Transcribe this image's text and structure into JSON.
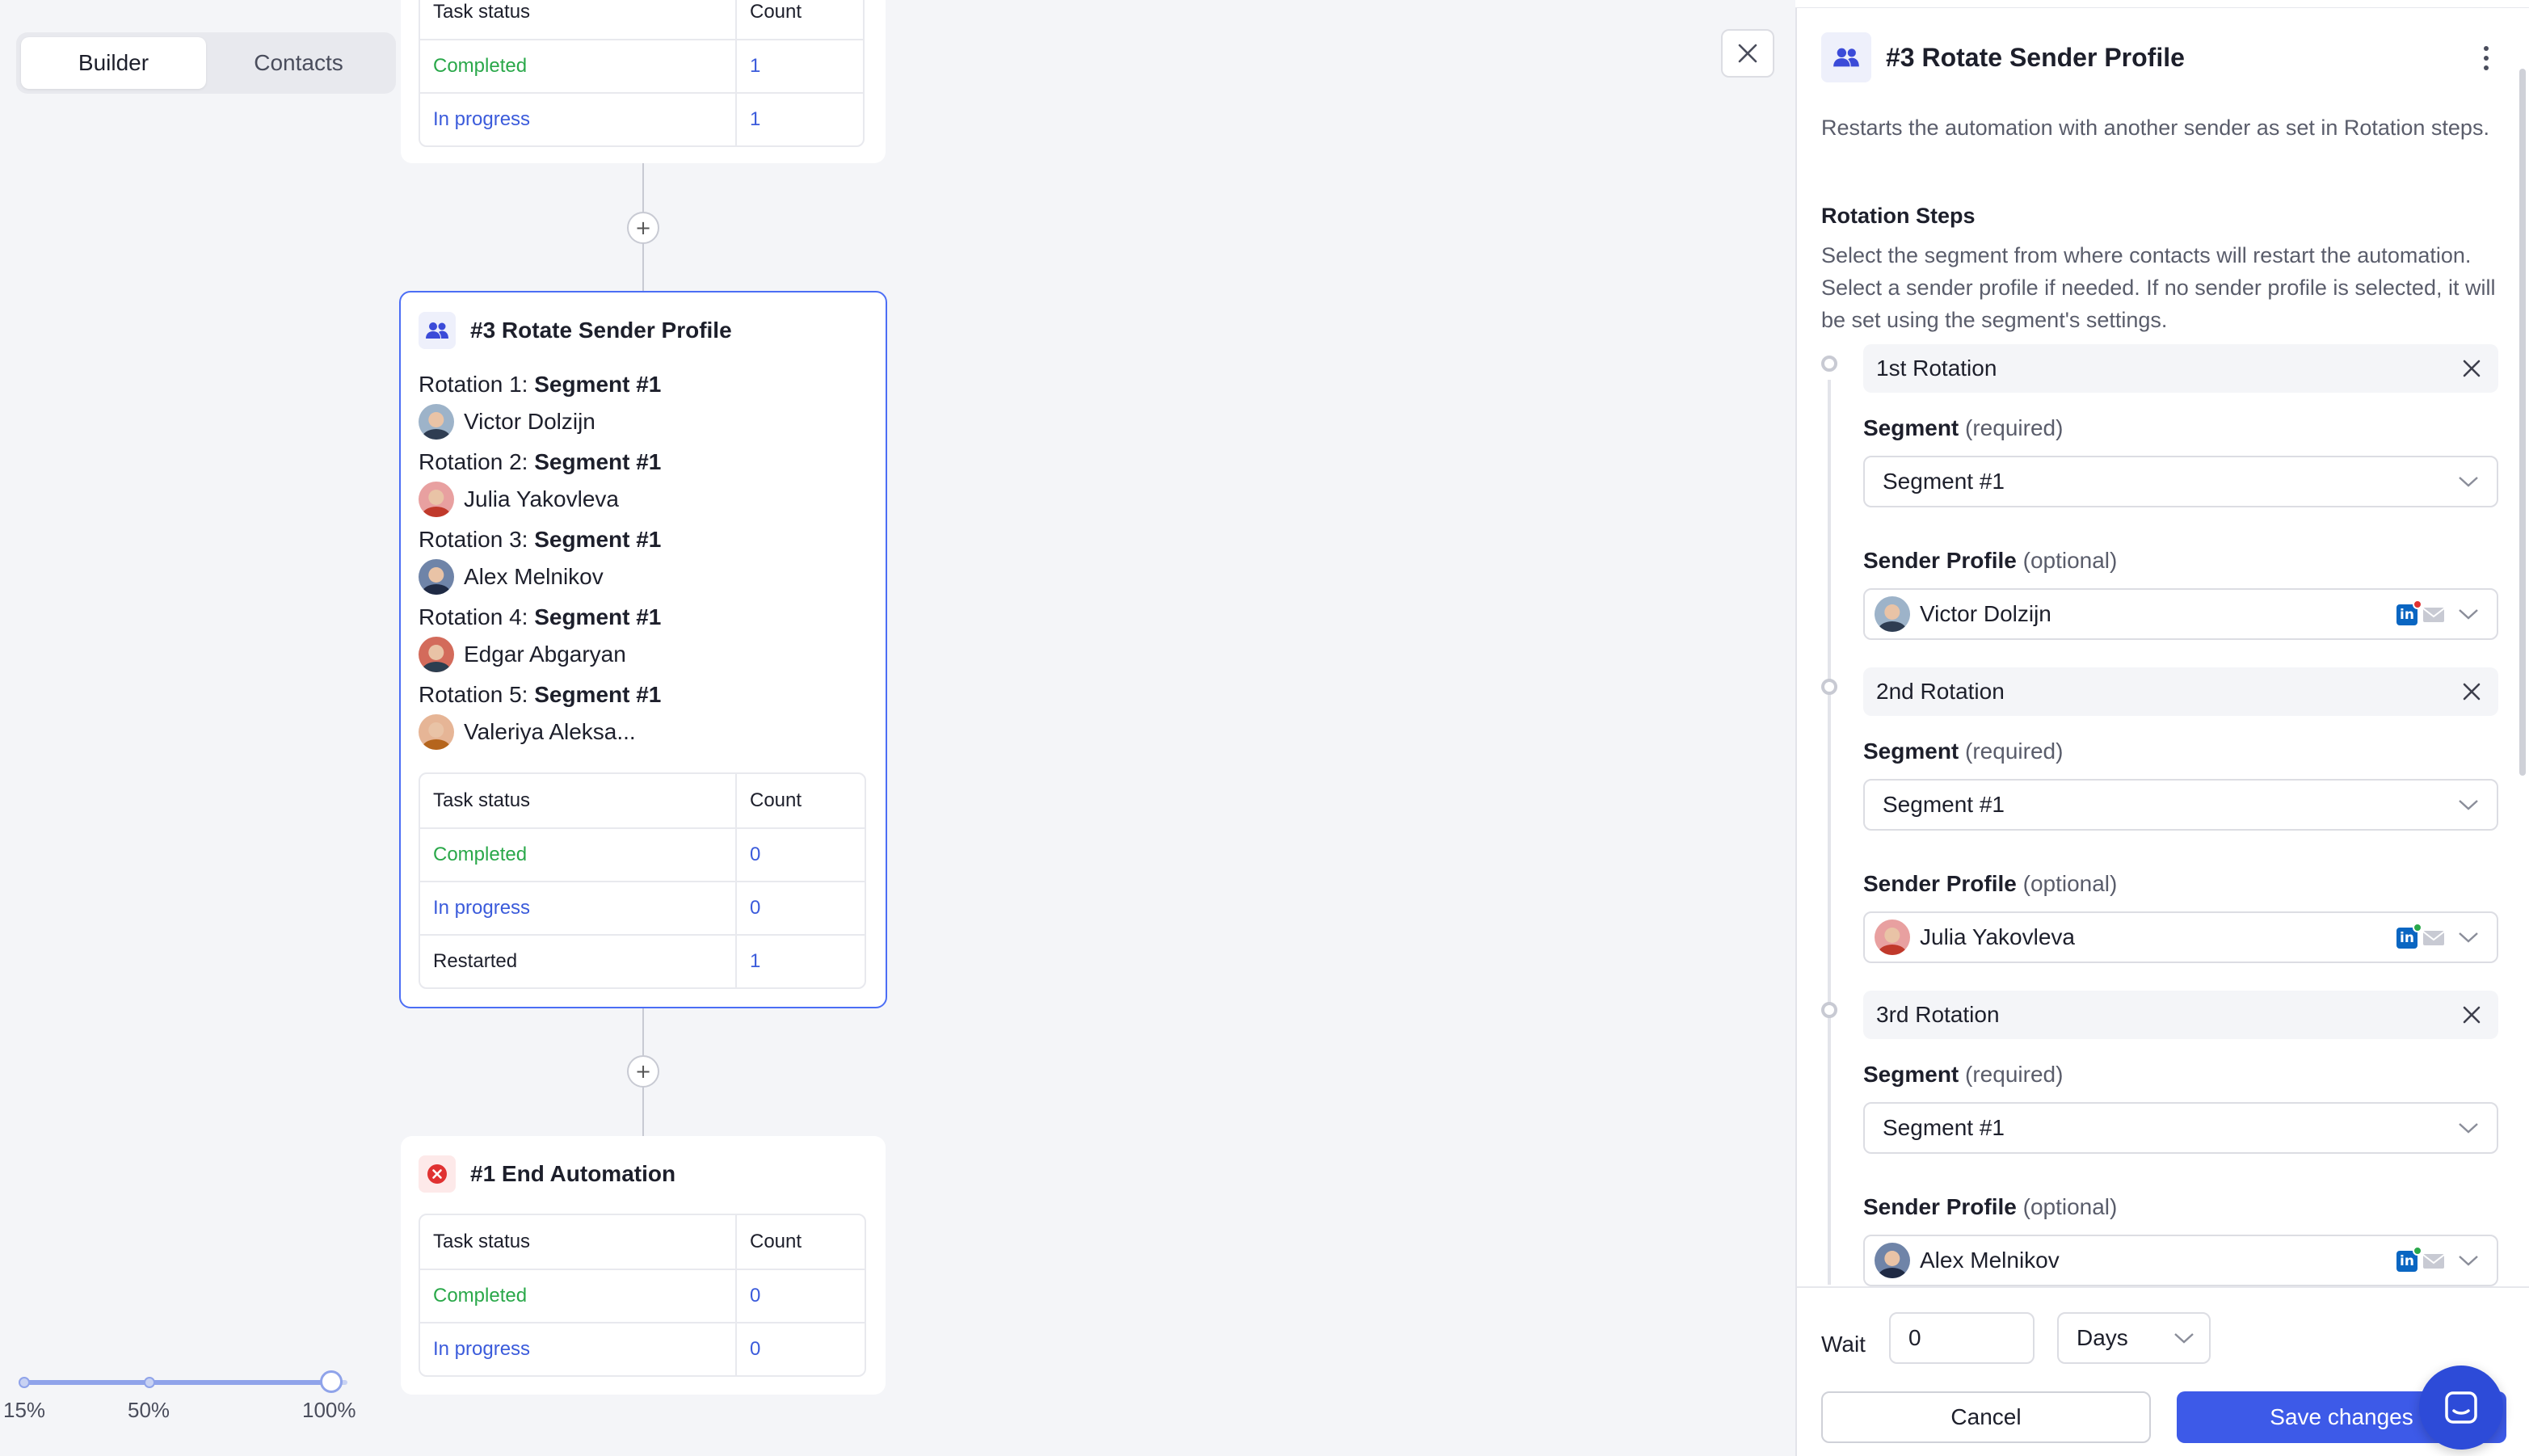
{
  "mode_switch": {
    "builder_label": "Builder",
    "contacts_label": "Contacts",
    "active": "Builder"
  },
  "top_card": {
    "header": {
      "status": "Task status",
      "count": "Count"
    },
    "rows": [
      {
        "status": "Completed",
        "count": "1"
      },
      {
        "status": "In progress",
        "count": "1"
      }
    ]
  },
  "rotate_card": {
    "title": "#3 Rotate Sender Profile",
    "rotations": [
      {
        "prefix": "Rotation 1: ",
        "segment": "Segment #1",
        "sender": "Victor Dolzijn"
      },
      {
        "prefix": "Rotation 2: ",
        "segment": "Segment #1",
        "sender": "Julia Yakovleva"
      },
      {
        "prefix": "Rotation 3: ",
        "segment": "Segment #1",
        "sender": "Alex Melnikov"
      },
      {
        "prefix": "Rotation 4: ",
        "segment": "Segment #1",
        "sender": "Edgar Abgaryan"
      },
      {
        "prefix": "Rotation 5: ",
        "segment": "Segment #1",
        "sender": "Valeriya Aleksa..."
      }
    ],
    "table": {
      "header": {
        "status": "Task status",
        "count": "Count"
      },
      "rows": [
        {
          "status": "Completed",
          "count": "0"
        },
        {
          "status": "In progress",
          "count": "0"
        },
        {
          "status": "Restarted",
          "count": "1"
        }
      ]
    }
  },
  "end_card": {
    "title": "#1 End Automation",
    "table": {
      "header": {
        "status": "Task status",
        "count": "Count"
      },
      "rows": [
        {
          "status": "Completed",
          "count": "0"
        },
        {
          "status": "In progress",
          "count": "0"
        }
      ]
    }
  },
  "zoom": {
    "labels": [
      "15%",
      "50%",
      "100%"
    ],
    "value_percent": 100
  },
  "panel": {
    "title": "#3 Rotate Sender Profile",
    "description": "Restarts the automation with another sender as set in Rotation steps.",
    "section_heading": "Rotation Steps",
    "section_help": "Select the segment from where contacts will restart the automation. Select a sender profile if needed. If no sender profile is selected, it will be set using the segment's settings.",
    "segment_label": "Segment",
    "segment_hint": "(required)",
    "sender_label": "Sender Profile",
    "sender_hint": "(optional)",
    "rotations": [
      {
        "name": "1st Rotation",
        "segment": "Segment #1",
        "sender": "Victor Dolzijn",
        "badge_color": "#e03131"
      },
      {
        "name": "2nd Rotation",
        "segment": "Segment #1",
        "sender": "Julia Yakovleva",
        "badge_color": "#2aa84a"
      },
      {
        "name": "3rd Rotation",
        "segment": "Segment #1",
        "sender": "Alex Melnikov",
        "badge_color": "#2aa84a"
      }
    ],
    "wait_label": "Wait",
    "wait_value": "0",
    "wait_unit": "Days",
    "cancel_label": "Cancel",
    "save_label": "Save changes"
  },
  "colors": {
    "accent": "#3d5ae8",
    "completed": "#2aa84a",
    "in_progress": "#3b5bdb"
  }
}
